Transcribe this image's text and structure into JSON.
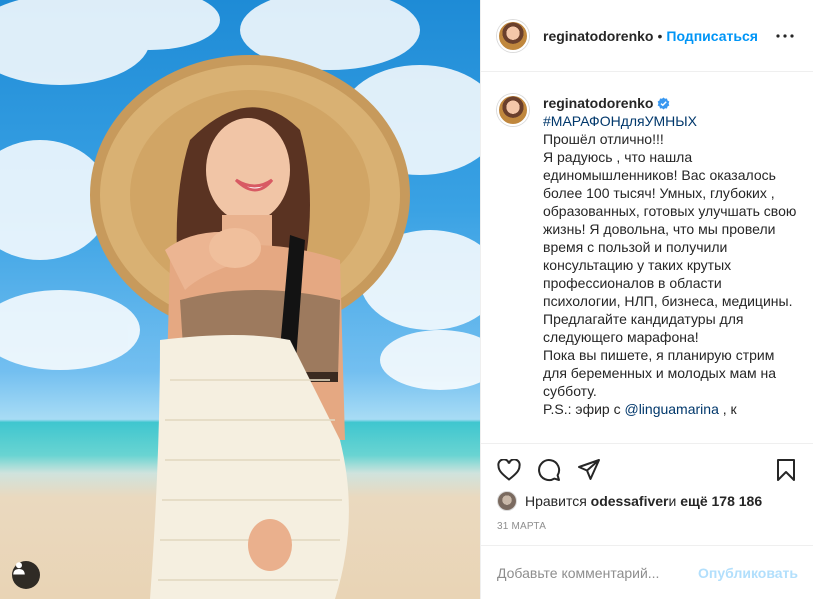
{
  "header": {
    "username": "reginatodorenko",
    "separator": "•",
    "follow_label": "Подписаться",
    "more_icon": "ellipsis-icon"
  },
  "caption": {
    "username": "reginatodorenko",
    "verified_icon": "verified-badge-icon",
    "hashtag": "#МАРАФОНдляУМНЫХ",
    "lines": [
      "Прошёл отлично!!!",
      "Я радуюсь , что нашла единомышленников! Вас оказалось более 100 тысяч! Умных, глубоких , образованных, готовых улучшать свою жизнь! Я довольна, что мы провели время с пользой и получили консультацию у таких крутых профессионалов в области психологии, НЛП, бизнеса, медицины.",
      "Предлагайте кандидатуры для следующего марафона!",
      "Пока вы пишете, я планирую стрим для беременных и молодых мам на субботу."
    ],
    "ps_prefix": "P.S.: эфир с ",
    "ps_mention": "@linguamarina",
    "ps_suffix": " , к"
  },
  "actions": {
    "like_icon": "heart-icon",
    "comment_icon": "comment-icon",
    "share_icon": "paper-plane-icon",
    "save_icon": "bookmark-icon"
  },
  "likes": {
    "prefix": "Нравится ",
    "user": "odessafiver",
    "middle": " и ",
    "count": "ещё 178 186"
  },
  "date": "31 марта",
  "comment": {
    "placeholder": "Добавьте комментарий...",
    "publish_label": "Опубликовать"
  },
  "photo": {
    "user_tag_icon": "person-icon"
  },
  "colors": {
    "accent": "#0095f6",
    "link": "#00376b",
    "publish_disabled": "#b2dffc",
    "muted": "#8e8e8e"
  }
}
